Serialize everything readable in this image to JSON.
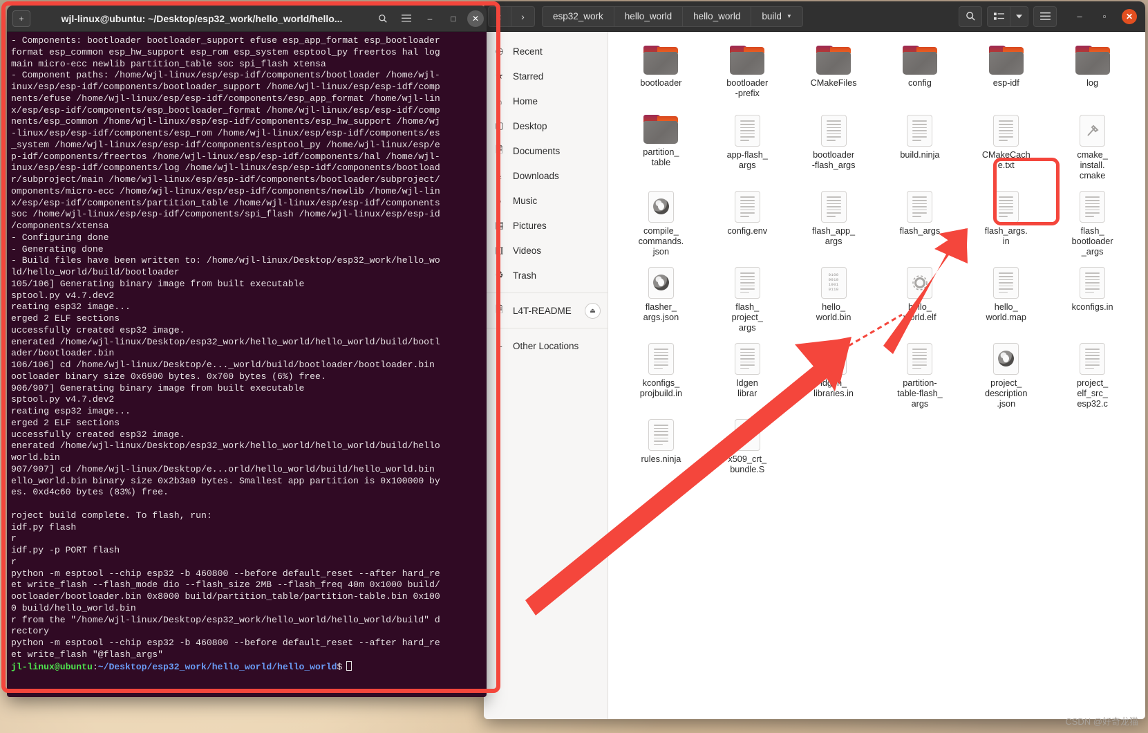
{
  "terminal": {
    "title": "wjl-linux@ubuntu: ~/Desktop/esp32_work/hello_world/hello...",
    "new_tab_icon": "new-tab-icon",
    "search_icon": "search-icon",
    "menu_icon": "hamburger-menu-icon",
    "minimize": "–",
    "maximize": "□",
    "close": "✕",
    "lines": [
      "- Components: bootloader bootloader_support efuse esp_app_format esp_bootloader",
      "format esp_common esp_hw_support esp_rom esp_system esptool_py freertos hal log",
      "main micro-ecc newlib partition_table soc spi_flash xtensa",
      "- Component paths: /home/wjl-linux/esp/esp-idf/components/bootloader /home/wjl-",
      "inux/esp/esp-idf/components/bootloader_support /home/wjl-linux/esp/esp-idf/comp",
      "nents/efuse /home/wjl-linux/esp/esp-idf/components/esp_app_format /home/wjl-lin",
      "x/esp/esp-idf/components/esp_bootloader_format /home/wjl-linux/esp/esp-idf/comp",
      "nents/esp_common /home/wjl-linux/esp/esp-idf/components/esp_hw_support /home/wj",
      "-linux/esp/esp-idf/components/esp_rom /home/wjl-linux/esp/esp-idf/components/es",
      "_system /home/wjl-linux/esp/esp-idf/components/esptool_py /home/wjl-linux/esp/e",
      "p-idf/components/freertos /home/wjl-linux/esp/esp-idf/components/hal /home/wjl-",
      "inux/esp/esp-idf/components/log /home/wjl-linux/esp/esp-idf/components/bootload",
      "r/subproject/main /home/wjl-linux/esp/esp-idf/components/bootloader/subproject/",
      "omponents/micro-ecc /home/wjl-linux/esp/esp-idf/components/newlib /home/wjl-lin",
      "x/esp/esp-idf/components/partition_table /home/wjl-linux/esp/esp-idf/components",
      "soc /home/wjl-linux/esp/esp-idf/components/spi_flash /home/wjl-linux/esp/esp-id",
      "/components/xtensa",
      "- Configuring done",
      "- Generating done",
      "- Build files have been written to: /home/wjl-linux/Desktop/esp32_work/hello_wo",
      "ld/hello_world/build/bootloader",
      "105/106] Generating binary image from built executable",
      "sptool.py v4.7.dev2",
      "reating esp32 image...",
      "erged 2 ELF sections",
      "uccessfully created esp32 image.",
      "enerated /home/wjl-linux/Desktop/esp32_work/hello_world/hello_world/build/bootl",
      "ader/bootloader.bin",
      "106/106] cd /home/wjl-linux/Desktop/e..._world/build/bootloader/bootloader.bin",
      "ootloader binary size 0x6900 bytes. 0x700 bytes (6%) free.",
      "906/907] Generating binary image from built executable",
      "sptool.py v4.7.dev2",
      "reating esp32 image...",
      "erged 2 ELF sections",
      "uccessfully created esp32 image.",
      "enerated /home/wjl-linux/Desktop/esp32_work/hello_world/hello_world/build/hello",
      "world.bin",
      "907/907] cd /home/wjl-linux/Desktop/e...orld/hello_world/build/hello_world.bin",
      "ello_world.bin binary size 0x2b3a0 bytes. Smallest app partition is 0x100000 by",
      "es. 0xd4c60 bytes (83%) free.",
      "",
      "roject build complete. To flash, run:",
      "idf.py flash",
      "r",
      "idf.py -p PORT flash",
      "r",
      "python -m esptool --chip esp32 -b 460800 --before default_reset --after hard_re",
      "et write_flash --flash_mode dio --flash_size 2MB --flash_freq 40m 0x1000 build/",
      "ootloader/bootloader.bin 0x8000 build/partition_table/partition-table.bin 0x100",
      "0 build/hello_world.bin",
      "r from the \"/home/wjl-linux/Desktop/esp32_work/hello_world/hello_world/build\" d",
      "rectory",
      "python -m esptool --chip esp32 -b 460800 --before default_reset --after hard_re",
      "et write_flash \"@flash_args\""
    ],
    "prompt": {
      "user": "jl-linux@ubuntu",
      "colon": ":",
      "path": "~/Desktop/esp32_work/hello_world/hello_world",
      "sigil": "$"
    }
  },
  "filemanager": {
    "nav": {
      "back": "‹",
      "forward": "›"
    },
    "breadcrumbs": [
      {
        "label": "esp32_work",
        "has_caret": false
      },
      {
        "label": "hello_world",
        "has_caret": false
      },
      {
        "label": "hello_world",
        "has_caret": false
      },
      {
        "label": "build",
        "has_caret": true
      }
    ],
    "tools": {
      "search": "search-icon",
      "view_list": "view-list-icon",
      "view_dropdown": "chevron-down-icon",
      "menu": "hamburger-menu-icon"
    },
    "window_controls": {
      "minimize": "–",
      "maximize": "▫",
      "close": "✕"
    },
    "sidebar": [
      {
        "label": "Recent",
        "icon": "clock-icon",
        "glyph": "◷"
      },
      {
        "label": "Starred",
        "icon": "star-icon",
        "glyph": "★"
      },
      {
        "label": "Home",
        "icon": "home-icon",
        "glyph": "⌂"
      },
      {
        "label": "Desktop",
        "icon": "desktop-icon",
        "glyph": "▢"
      },
      {
        "label": "Documents",
        "icon": "documents-icon",
        "glyph": "🗎"
      },
      {
        "label": "Downloads",
        "icon": "downloads-icon",
        "glyph": "⤓"
      },
      {
        "label": "Music",
        "icon": "music-icon",
        "glyph": "♪"
      },
      {
        "label": "Pictures",
        "icon": "pictures-icon",
        "glyph": "▤"
      },
      {
        "label": "Videos",
        "icon": "videos-icon",
        "glyph": "▥"
      },
      {
        "label": "Trash",
        "icon": "trash-icon",
        "glyph": "♻"
      }
    ],
    "sidebar_devices": [
      {
        "label": "L4T-README",
        "icon": "disc-icon",
        "glyph": "🗎",
        "eject": "⏏"
      }
    ],
    "sidebar_other": [
      {
        "label": "Other Locations",
        "icon": "network-icon",
        "glyph": "–"
      }
    ],
    "files": [
      {
        "name": "bootloader",
        "type": "folder"
      },
      {
        "name": "bootloader\n-prefix",
        "type": "folder"
      },
      {
        "name": "CMakeFiles",
        "type": "folder"
      },
      {
        "name": "config",
        "type": "folder"
      },
      {
        "name": "esp-idf",
        "type": "folder"
      },
      {
        "name": "log",
        "type": "folder"
      },
      {
        "name": "partition_\ntable",
        "type": "folder"
      },
      {
        "name": "app-flash_\nargs",
        "type": "doc"
      },
      {
        "name": "bootloader\n-flash_args",
        "type": "doc"
      },
      {
        "name": "build.ninja",
        "type": "doc"
      },
      {
        "name": "CMakeCach\ne.txt",
        "type": "doc"
      },
      {
        "name": "cmake_\ninstall.\ncmake",
        "type": "cmake"
      },
      {
        "name": "compile_\ncommands.\njson",
        "type": "json"
      },
      {
        "name": "config.env",
        "type": "doc"
      },
      {
        "name": "flash_app_\nargs",
        "type": "doc"
      },
      {
        "name": "flash_args",
        "type": "doc"
      },
      {
        "name": "flash_args.\nin",
        "type": "doc"
      },
      {
        "name": "flash_\nbootloader\n_args",
        "type": "doc"
      },
      {
        "name": "flasher_\nargs.json",
        "type": "json"
      },
      {
        "name": "flash_\nproject_\nargs",
        "type": "doc"
      },
      {
        "name": "hello_\nworld.bin",
        "type": "bin",
        "selected": true
      },
      {
        "name": "hello_\nworld.elf",
        "type": "elf"
      },
      {
        "name": "hello_\nworld.map",
        "type": "doc"
      },
      {
        "name": "kconfigs.in",
        "type": "doc"
      },
      {
        "name": "kconfigs_\nprojbuild.in",
        "type": "doc"
      },
      {
        "name": "ldgen\nlibrar",
        "type": "doc"
      },
      {
        "name": "ldgen_\nlibraries.in",
        "type": "doc"
      },
      {
        "name": "partition-\ntable-flash_\nargs",
        "type": "doc"
      },
      {
        "name": "project_\ndescription\n.json",
        "type": "json"
      },
      {
        "name": "project_\nelf_src_\nesp32.c",
        "type": "doc"
      },
      {
        "name": "rules.ninja",
        "type": "doc"
      },
      {
        "name": "x509_crt_\nbundle.S",
        "type": "c"
      }
    ]
  },
  "annotations": {
    "terminal_highlight_color": "#f4463c",
    "selection_highlight_color": "#f4463c",
    "arrow_color": "#f4463c"
  },
  "watermark": "CSDN @好奇龙猫"
}
